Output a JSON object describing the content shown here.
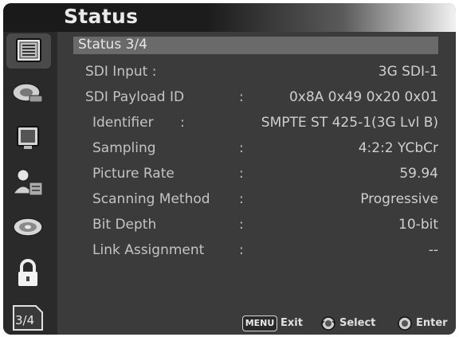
{
  "title": "Status",
  "sidebar": {
    "items": [
      {
        "icon": "status-icon"
      },
      {
        "icon": "video-adjust-icon"
      },
      {
        "icon": "monitor-icon"
      },
      {
        "icon": "user-icon"
      },
      {
        "icon": "audio-icon"
      },
      {
        "icon": "lock-icon"
      }
    ],
    "page_label": "3/4"
  },
  "section": {
    "header": "Status 3/4"
  },
  "rows": [
    {
      "label": "SDI Input :",
      "colon": "",
      "value": "3G SDI-1"
    },
    {
      "label": "SDI Payload ID",
      "colon": ":",
      "value": "0x8A 0x49 0x20 0x01"
    },
    {
      "label": "Identifier",
      "colon": ":",
      "value": "SMPTE ST 425-1(3G Lvl B)"
    },
    {
      "label": "Sampling",
      "colon": ":",
      "value": "4:2:2 YCbCr"
    },
    {
      "label": "Picture Rate",
      "colon": ":",
      "value": "59.94"
    },
    {
      "label": "Scanning Method",
      "colon": ":",
      "value": "Progressive"
    },
    {
      "label": "Bit Depth",
      "colon": ":",
      "value": "10-bit"
    },
    {
      "label": "Link Assignment",
      "colon": ":",
      "value": "--"
    }
  ],
  "footer": {
    "menu_badge": "MENU",
    "exit_label": "Exit",
    "select_label": "Select",
    "enter_label": "Enter"
  }
}
